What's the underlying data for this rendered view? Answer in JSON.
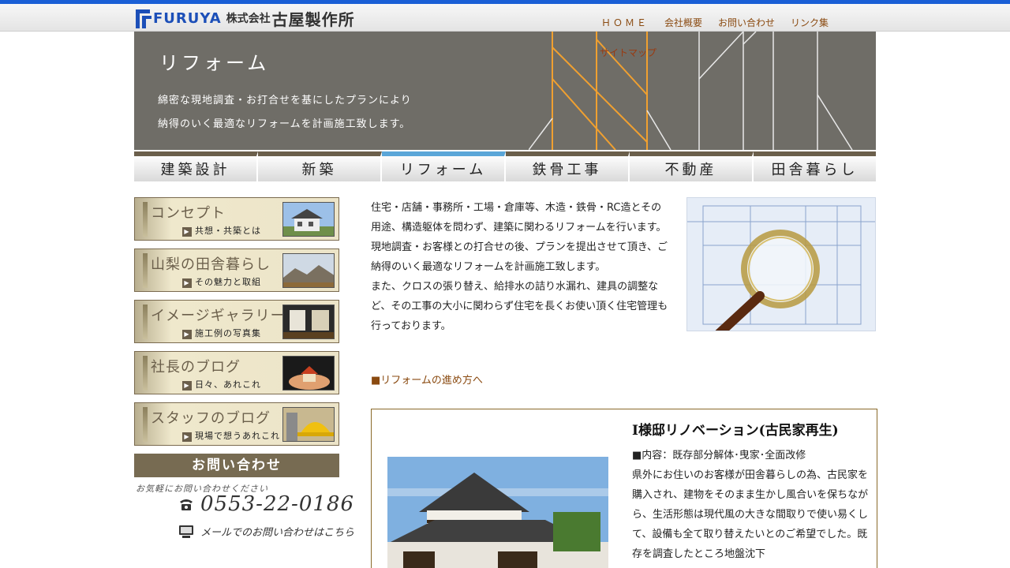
{
  "header": {
    "logo_en": "FURUYA",
    "logo_company_prefix": "株式会社",
    "logo_company_name": "古屋製作所",
    "nav": [
      "ＨＯＭＥ",
      "会社概要",
      "お問い合わせ",
      "リンク集"
    ]
  },
  "hero": {
    "title": "リフォーム",
    "sitemap": "サイトマップ",
    "line1": "綿密な現地調査・お打合せを基にしたプランにより",
    "line2": "納得のいく最適なリフォームを計画施工致します。"
  },
  "mainnav": {
    "tabs": [
      "建築設計",
      "新築",
      "リフォーム",
      "鉄骨工事",
      "不動産",
      "田舎暮らし"
    ],
    "active_index": 2,
    "accent_color": "#5aa6d8"
  },
  "sidebar": {
    "cards": [
      {
        "title": "コンセプト",
        "sub": "共想・共築とは"
      },
      {
        "title": "山梨の田舎暮らし",
        "sub": "その魅力と取組"
      },
      {
        "title": "イメージギャラリー",
        "sub": "施工例の写真集"
      },
      {
        "title": "社長のブログ",
        "sub": "日々、あれこれ"
      },
      {
        "title": "スタッフのブログ",
        "sub": "現場で想うあれこれ"
      }
    ],
    "contact": {
      "heading": "お問い合わせ",
      "sub": "お気軽にお問い合わせください",
      "phone": "0553-22-0186",
      "mail": "メールでのお問い合わせはこちら"
    }
  },
  "main": {
    "intro_p1": "住宅・店舗・事務所・工場・倉庫等、木造・鉄骨・RC造とその用途、構造躯体を問わず、建築に関わるリフォームを行います。現地調査・お客様との打合せの後、プランを提出させて頂き、ご納得のいく最適なリフォームを計画施工致します。",
    "intro_p2": "また、クロスの張り替え、給排水の詰り水漏れ、建具の調整など、その工事の大小に関わらず住宅を長くお使い頂く住宅管理も行っております。",
    "link": "■リフォームの進め方へ",
    "case": {
      "title": "I様邸リノベーション(古民家再生)",
      "content_line": "■内容：既存部分解体･曳家･全面改修",
      "body": "県外にお住いのお客様が田舎暮らしの為、古民家を購入され、建物をそのまま生かし風合いを保ちながら、生活形態は現代風の大きな間取りで使い易くして、設備も全て取り替えたいとのご希望でした。既存を調査したところ地盤沈下"
    }
  },
  "colors": {
    "top_bar": "#1a5fd6",
    "hero_bg": "#6f6d67",
    "nav_text": "#8a4a10",
    "sidebar_brown": "#776b52"
  }
}
